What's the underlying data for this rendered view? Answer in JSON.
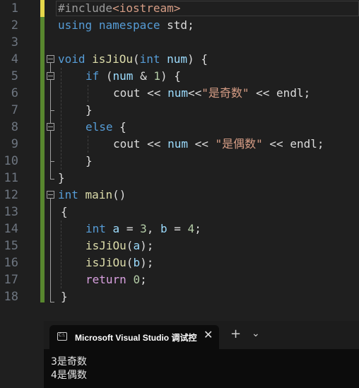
{
  "editor": {
    "line_numbers": [
      "1",
      "2",
      "3",
      "4",
      "5",
      "6",
      "7",
      "8",
      "9",
      "10",
      "11",
      "12",
      "13",
      "14",
      "15",
      "16",
      "17",
      "18"
    ],
    "lines": {
      "l1": {
        "pp": "#include",
        "lt": "<",
        "hdr": "iostream",
        "gt": ">"
      },
      "l2": {
        "kw1": "using",
        "kw2": "namespace",
        "name": "std",
        "semi": ";"
      },
      "l4": {
        "kw": "void",
        "fn": "isJiOu",
        "open": "(",
        "type": "int",
        "param": "num",
        "close": ")",
        "brace": " {"
      },
      "l5": {
        "kw": "if",
        "open": " (",
        "var": "num",
        "op": " & ",
        "num": "1",
        "rest": ") {"
      },
      "l6": {
        "a": "cout",
        "b": " << ",
        "c": "num",
        "d": "<<",
        "s": "\"是奇数\"",
        "e": " << ",
        "f": "endl",
        "g": ";"
      },
      "l7": {
        "t": "}"
      },
      "l8": {
        "kw": "else",
        "rest": " {"
      },
      "l9": {
        "a": "cout",
        "b": " << ",
        "c": "num",
        "d": " << ",
        "s": "\"是偶数\"",
        "e": " << ",
        "f": "endl",
        "g": ";"
      },
      "l10": {
        "t": "}"
      },
      "l11": {
        "t": "}"
      },
      "l12": {
        "kw": "int",
        "fn": "main",
        "rest": "()"
      },
      "l13": {
        "t": "{"
      },
      "l14": {
        "kw": "int",
        "v1": "a",
        "eq1": " = ",
        "n1": "3",
        "comma": ", ",
        "v2": "b",
        "eq2": " = ",
        "n2": "4",
        "semi": ";"
      },
      "l15": {
        "fn": "isJiOu",
        "open": "(",
        "v": "a",
        "close": ");"
      },
      "l16": {
        "fn": "isJiOu",
        "open": "(",
        "v": "b",
        "close": ");"
      },
      "l17": {
        "kw": "return",
        "n": "0",
        "semi": ";"
      },
      "l18": {
        "t": "}"
      }
    }
  },
  "terminal": {
    "tab_title": "Microsoft Visual Studio 调试控",
    "tab_icon_text": "C:\\",
    "close_label": "✕",
    "new_tab_label": "+",
    "dropdown_label": "⌄",
    "output": [
      "3是奇数",
      "4是偶数"
    ]
  },
  "colors": {
    "keyword": "#569cd6",
    "function": "#dcdcaa",
    "string": "#d69d85",
    "number": "#b5cea8",
    "change_bar": "#58872e",
    "current_line_bar": "#e5d74a"
  }
}
